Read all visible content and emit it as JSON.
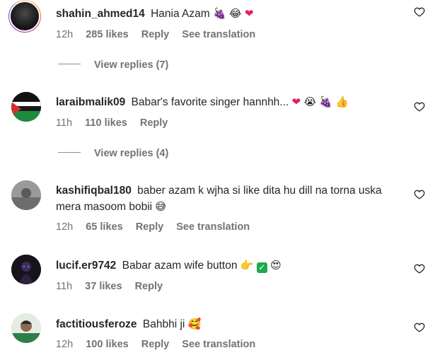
{
  "comments": [
    {
      "username": "shahin_ahmed14",
      "text": "Hania Azam",
      "emojis": [
        "🍇",
        "😂",
        "❤"
      ],
      "time": "12h",
      "likes": "285 likes",
      "reply": "Reply",
      "translation": "See translation",
      "view_replies": "View replies (7)"
    },
    {
      "username": "laraibmalik09",
      "text": "Babar's favorite singer hannhh...",
      "emojis": [
        "❤",
        "😭",
        "🍇",
        "👍"
      ],
      "time": "11h",
      "likes": "110 likes",
      "reply": "Reply",
      "view_replies": "View replies (4)"
    },
    {
      "username": "kashifiqbal180",
      "text": "baber azam k wjha si like dita hu dill na torna uska mera masoom bobii",
      "emojis": [
        "😅"
      ],
      "time": "12h",
      "likes": "65 likes",
      "reply": "Reply",
      "translation": "See translation"
    },
    {
      "username": "lucif.er9742",
      "text": "Babar azam wife button",
      "emojis": [
        "👉",
        "✓",
        "😍"
      ],
      "time": "11h",
      "likes": "37 likes",
      "reply": "Reply"
    },
    {
      "username": "factitiousferoze",
      "text": "Bahbhi ji",
      "emojis": [
        "🥰"
      ],
      "time": "12h",
      "likes": "100 likes",
      "reply": "Reply",
      "translation": "See translation"
    }
  ],
  "icons": {
    "like": "heart-outline-icon"
  },
  "colors": {
    "meta": "#737373",
    "text": "#262626"
  }
}
